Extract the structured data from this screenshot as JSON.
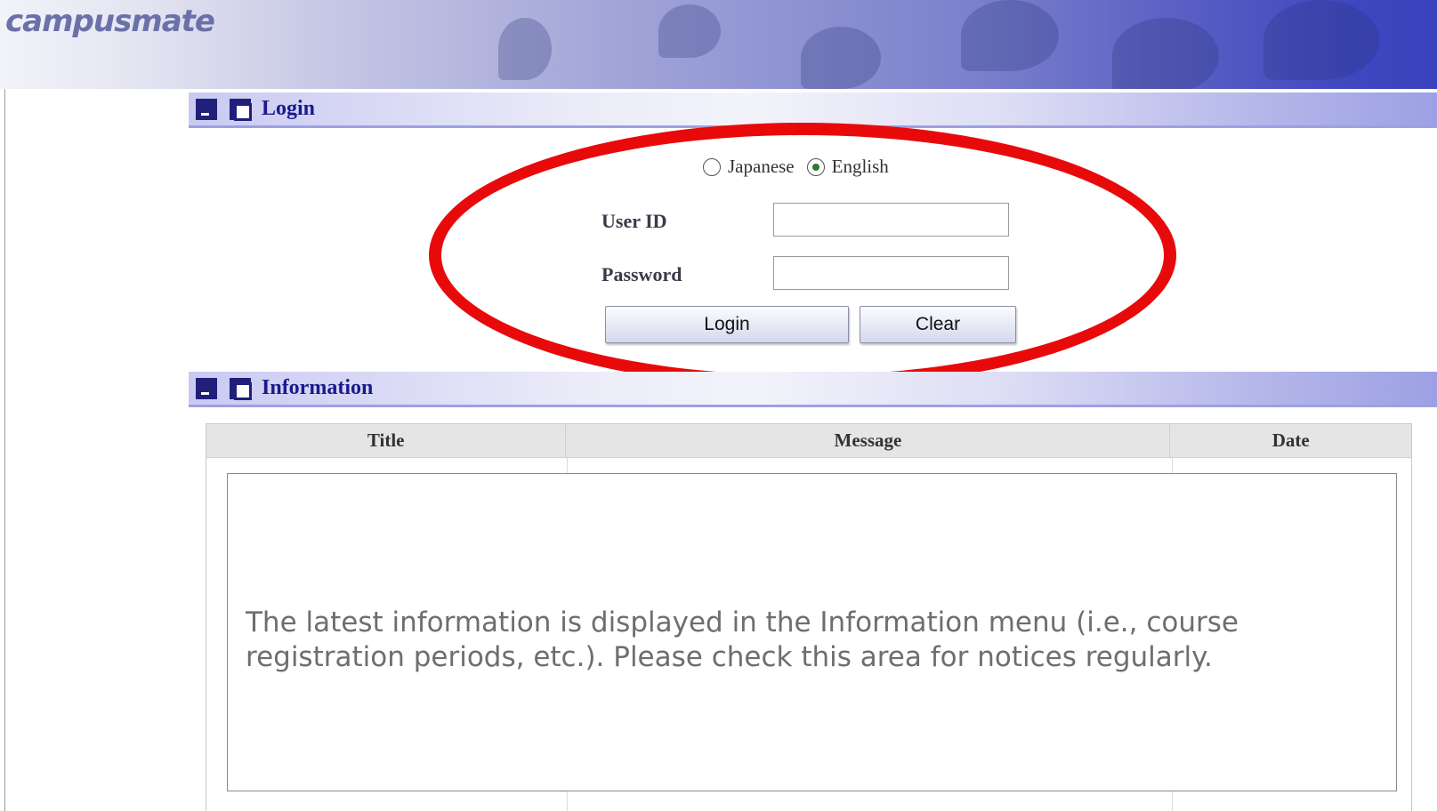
{
  "header": {
    "logo": "campusmate"
  },
  "login_section": {
    "title": "Login",
    "language": {
      "options": [
        "Japanese",
        "English"
      ],
      "selected": "English"
    },
    "user_id_label": "User ID",
    "user_id_value": "",
    "password_label": "Password",
    "password_value": "",
    "login_button": "Login",
    "clear_button": "Clear"
  },
  "info_section": {
    "title": "Information",
    "columns": [
      "Title",
      "Message",
      "Date"
    ],
    "notice": "The latest information is displayed in the Information menu (i.e., course registration periods, etc.). Please check this area for notices regularly."
  },
  "colors": {
    "highlight": "#e80a0a",
    "section_title": "#1a1a8c",
    "header_dark": "#3a42bd"
  },
  "icons": {
    "minimize": "minimize-icon",
    "maximize": "maximize-icon"
  }
}
